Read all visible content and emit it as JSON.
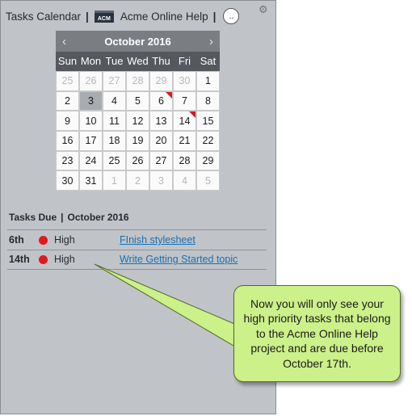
{
  "header": {
    "title": "Tasks Calendar",
    "project_name": "Acme Online Help",
    "project_icon_text": "ACM",
    "avatar_text": ".."
  },
  "calendar": {
    "month_label": "October 2016",
    "prev": "‹",
    "next": "›",
    "weekdays": [
      "Sun",
      "Mon",
      "Tue",
      "Wed",
      "Thu",
      "Fri",
      "Sat"
    ],
    "weeks": [
      [
        "25",
        "26",
        "27",
        "28",
        "29",
        "30",
        "1"
      ],
      [
        "2",
        "3",
        "4",
        "5",
        "6",
        "7",
        "8"
      ],
      [
        "9",
        "10",
        "11",
        "12",
        "13",
        "14",
        "15"
      ],
      [
        "16",
        "17",
        "18",
        "19",
        "20",
        "21",
        "22"
      ],
      [
        "23",
        "24",
        "25",
        "26",
        "27",
        "28",
        "29"
      ],
      [
        "30",
        "31",
        "1",
        "2",
        "3",
        "4",
        "5"
      ]
    ],
    "today": "3",
    "flagged_days": [
      "6",
      "14"
    ]
  },
  "tasks_due": {
    "title": "Tasks Due",
    "month": "October 2016",
    "items": [
      {
        "date": "6th",
        "priority": "High",
        "task": "FInish stylesheet "
      },
      {
        "date": "14th",
        "priority": "High",
        "task": "Write Getting Started topic "
      }
    ]
  },
  "callout": {
    "text": "Now you will only see your high priority tasks that belong to the Acme Online Help project and are due before October 17th."
  },
  "colors": {
    "panel_bg": "#c0c4c8",
    "calendar_header": "#7a7e82",
    "weekday_bar": "#55595d",
    "priority_high": "#e0191c",
    "link": "#1a6fb3",
    "callout_bg": "#ccf08a"
  }
}
